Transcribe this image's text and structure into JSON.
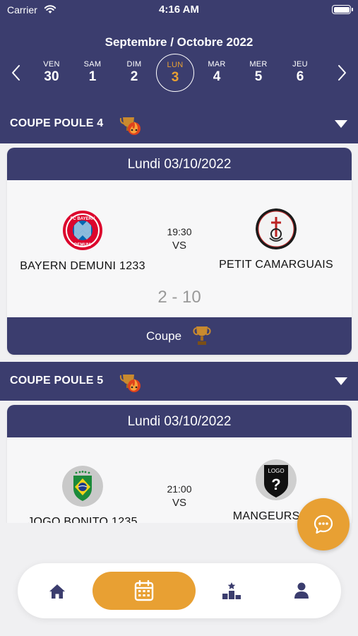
{
  "status_bar": {
    "carrier": "Carrier",
    "time": "4:16 AM"
  },
  "calendar": {
    "month_title": "Septembre / Octobre 2022",
    "days": [
      {
        "name": "VEN",
        "num": "30"
      },
      {
        "name": "SAM",
        "num": "1"
      },
      {
        "name": "DIM",
        "num": "2"
      },
      {
        "name": "LUN",
        "num": "3"
      },
      {
        "name": "MAR",
        "num": "4"
      },
      {
        "name": "MER",
        "num": "5"
      },
      {
        "name": "JEU",
        "num": "6"
      }
    ],
    "selected_index": 3
  },
  "groups": [
    {
      "title": "COUPE POULE 4",
      "match": {
        "date": "Lundi 03/10/2022",
        "home": "BAYERN DEMUNI 1233",
        "away": "PETIT CAMARGUAIS",
        "time": "19:30",
        "vs": "VS",
        "score": "2 - 10",
        "competition": "Coupe"
      }
    },
    {
      "title": "COUPE POULE 5",
      "match": {
        "date": "Lundi 03/10/2022",
        "home": "JOGO BONITO 1235",
        "away": "MANGEURS DE FEUILLES",
        "time": "21:00",
        "vs": "VS"
      }
    }
  ],
  "logos": {
    "bayern_text_top": "FC BAYERN",
    "bayern_text_bottom": "DEMUNI",
    "generic_logo_text": "LOGO"
  },
  "tabbar": {
    "items": [
      "home-icon",
      "calendar-icon",
      "podium-icon",
      "user-icon"
    ],
    "active": "calendar-icon"
  },
  "colors": {
    "primary": "#3b3d6e",
    "accent": "#e8a033",
    "background": "#f0f0f2",
    "score": "#999999"
  }
}
